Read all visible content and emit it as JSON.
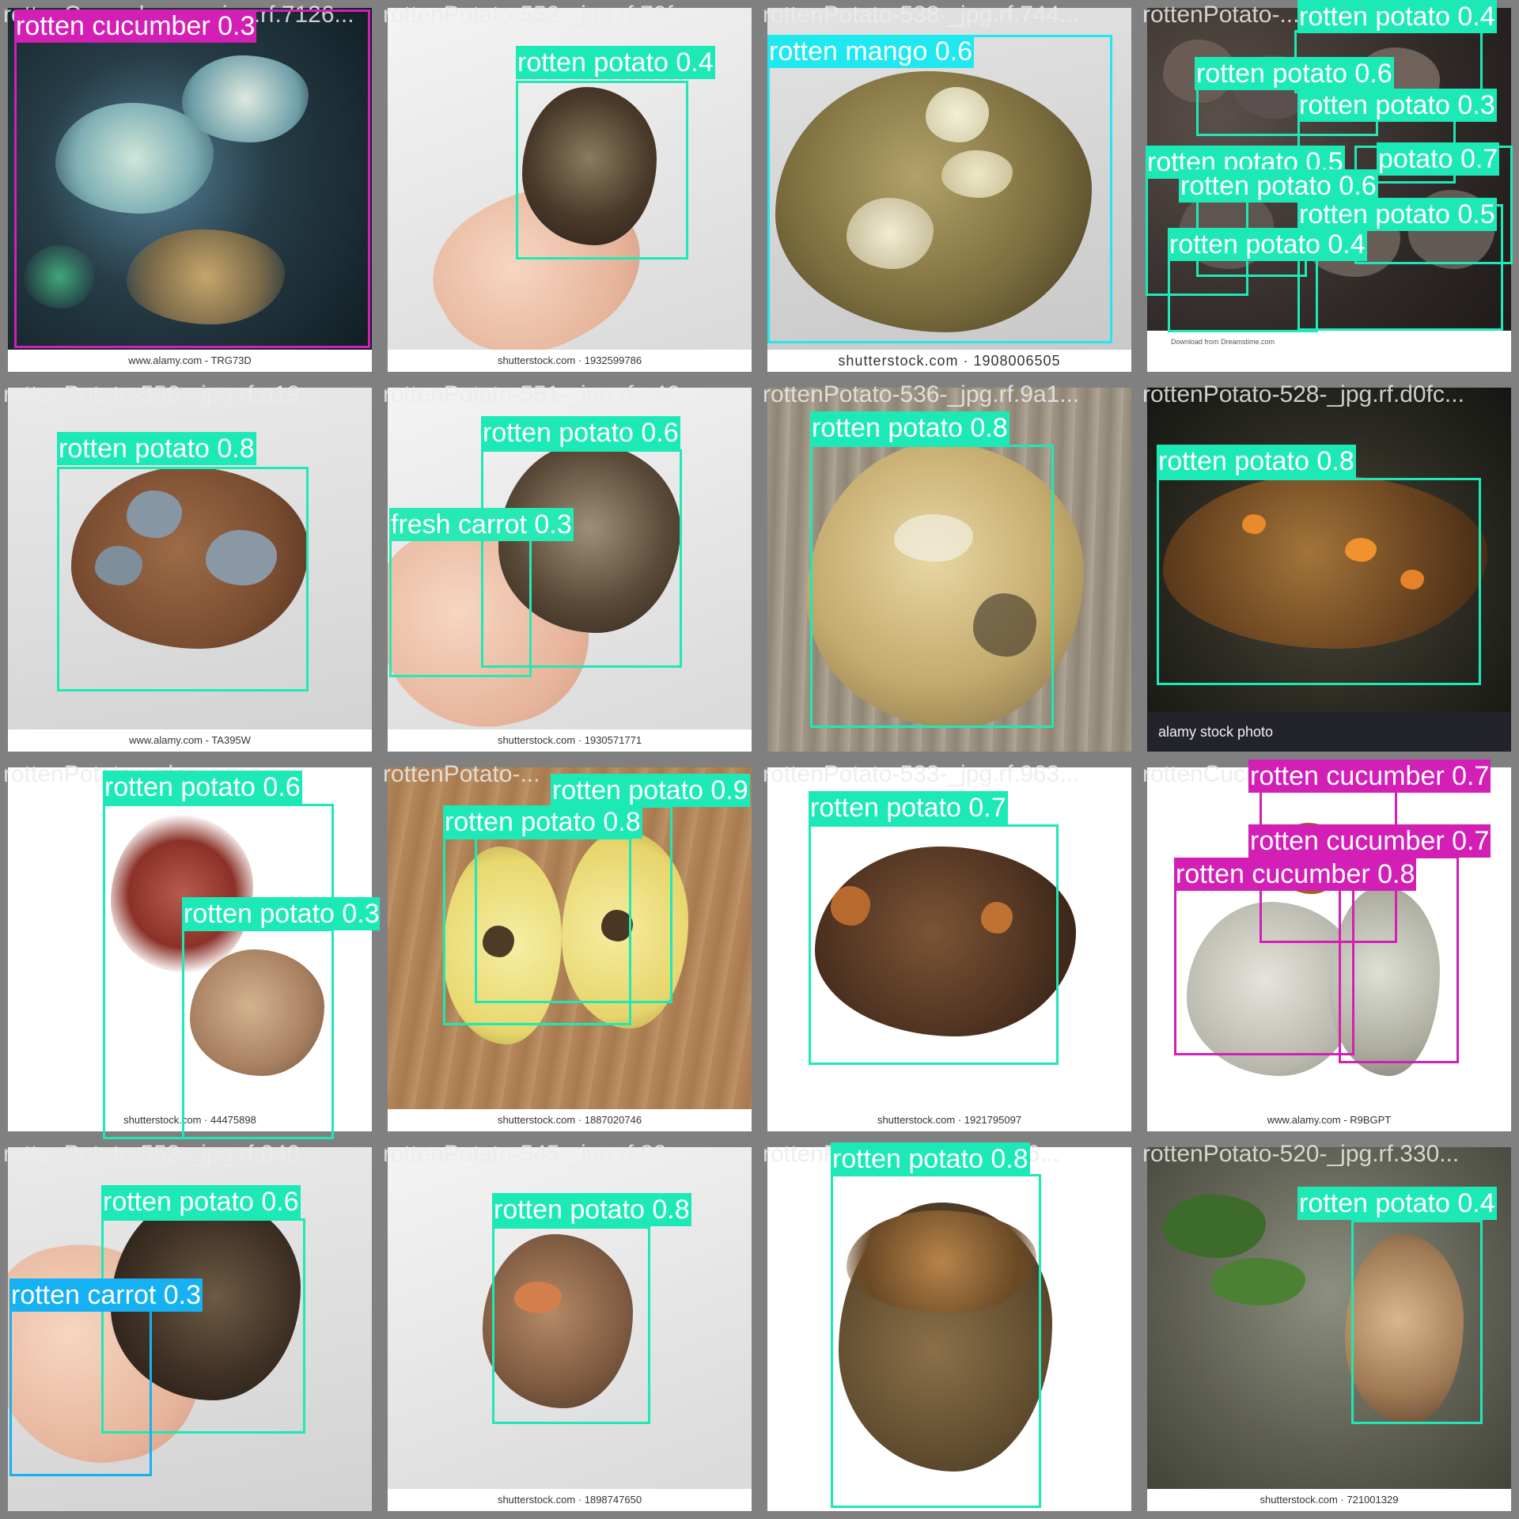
{
  "colors": {
    "rotten_potato": "#1de9b6",
    "rotten_cucumber": "#d31fb5",
    "rotten_mango": "#1fe8f0",
    "fresh_carrot": "#26e9b4",
    "rotten_carrot": "#15b1f2"
  },
  "tiles": [
    {
      "filename": "rottenCucumber-...-_jpg.rf.7126...",
      "watermark": "www.alamy.com - TRG73D",
      "detections": [
        {
          "label": "rotten cucumber 0.3",
          "class": "rotten_cucumber"
        }
      ]
    },
    {
      "filename": "rottenPotato-552-_jpg.rf.79f...",
      "watermark": "shutterstock.com · 1932599786",
      "detections": [
        {
          "label": "rotten potato 0.4",
          "class": "rotten_potato"
        }
      ]
    },
    {
      "filename": "rottenPotato-538-_jpg.rf.744...",
      "watermark": "shutterstock.com · 1908006505",
      "detections": [
        {
          "label": "rotten mango 0.6",
          "class": "rotten_mango"
        }
      ]
    },
    {
      "filename": "rottenPotato-...",
      "watermark": "Download from Dreamstime.com",
      "detections": [
        {
          "label": "rotten potato 0.4",
          "class": "rotten_potato"
        },
        {
          "label": "rotten potato 0.6",
          "class": "rotten_potato"
        },
        {
          "label": "rotten potato 0.3",
          "class": "rotten_potato"
        },
        {
          "label": "rotten potato 0.5",
          "class": "rotten_potato"
        },
        {
          "label": "potato 0.7",
          "class": "rotten_potato"
        },
        {
          "label": "rotten potato 0.6",
          "class": "rotten_potato"
        },
        {
          "label": "rotten potato 0.5",
          "class": "rotten_potato"
        },
        {
          "label": "rotten potato 0.4",
          "class": "rotten_potato"
        }
      ]
    },
    {
      "filename": "rottenPotato-556-_jpg.rf.a19...",
      "watermark": "www.alamy.com - TA395W",
      "detections": [
        {
          "label": "rotten potato 0.8",
          "class": "rotten_potato"
        }
      ]
    },
    {
      "filename": "rottenPotato-551-_jpg.rf.e46...",
      "watermark": "shutterstock.com · 1930571771",
      "detections": [
        {
          "label": "rotten potato 0.6",
          "class": "rotten_potato"
        },
        {
          "label": "fresh carrot 0.3",
          "class": "fresh_carrot"
        }
      ]
    },
    {
      "filename": "rottenPotato-536-_jpg.rf.9a1...",
      "watermark": "",
      "detections": [
        {
          "label": "rotten potato 0.8",
          "class": "rotten_potato"
        }
      ]
    },
    {
      "filename": "rottenPotato-528-_jpg.rf.d0fc...",
      "watermark": "alamy stock photo",
      "detections": [
        {
          "label": "rotten potato 0.8",
          "class": "rotten_potato"
        }
      ]
    },
    {
      "filename": "rottenPotato-...dca...",
      "watermark": "shutterstock.com · 44475898",
      "detections": [
        {
          "label": "rotten potato 0.6",
          "class": "rotten_potato"
        },
        {
          "label": "rotten potato 0.3",
          "class": "rotten_potato"
        }
      ]
    },
    {
      "filename": "rottenPotato-...",
      "watermark": "shutterstock.com · 1887020746",
      "detections": [
        {
          "label": "rotten potato 0.9",
          "class": "rotten_potato"
        },
        {
          "label": "rotten potato 0.8",
          "class": "rotten_potato"
        }
      ]
    },
    {
      "filename": "rottenPotato-533-_jpg.rf.963...",
      "watermark": "shutterstock.com · 1921795097",
      "detections": [
        {
          "label": "rotten potato 0.7",
          "class": "rotten_potato"
        }
      ]
    },
    {
      "filename": "rottenCucumber-...-_jpg.rf.72...",
      "watermark": "www.alamy.com - R9BGPT",
      "detections": [
        {
          "label": "rotten cucumber 0.7",
          "class": "rotten_cucumber"
        },
        {
          "label": "rotten cucumber 0.7",
          "class": "rotten_cucumber"
        },
        {
          "label": "rotten cucumber 0.8",
          "class": "rotten_cucumber"
        }
      ]
    },
    {
      "filename": "rottenPotato-553-_jpg.rf.040...",
      "watermark": "",
      "detections": [
        {
          "label": "rotten potato 0.6",
          "class": "rotten_potato"
        },
        {
          "label": "rotten carrot 0.3",
          "class": "rotten_carrot"
        }
      ]
    },
    {
      "filename": "rottenPotato-545-_jpg.rf.83...",
      "watermark": "shutterstock.com · 1898747650",
      "detections": [
        {
          "label": "rotten potato 0.8",
          "class": "rotten_potato"
        }
      ]
    },
    {
      "filename": "rottenPotato-...-_jpg.rf.866...",
      "watermark": "",
      "detections": [
        {
          "label": "rotten potato 0.8",
          "class": "rotten_potato"
        }
      ]
    },
    {
      "filename": "rottenPotato-520-_jpg.rf.330...",
      "watermark": "shutterstock.com · 721001329",
      "detections": [
        {
          "label": "rotten potato 0.4",
          "class": "rotten_potato"
        }
      ]
    }
  ]
}
